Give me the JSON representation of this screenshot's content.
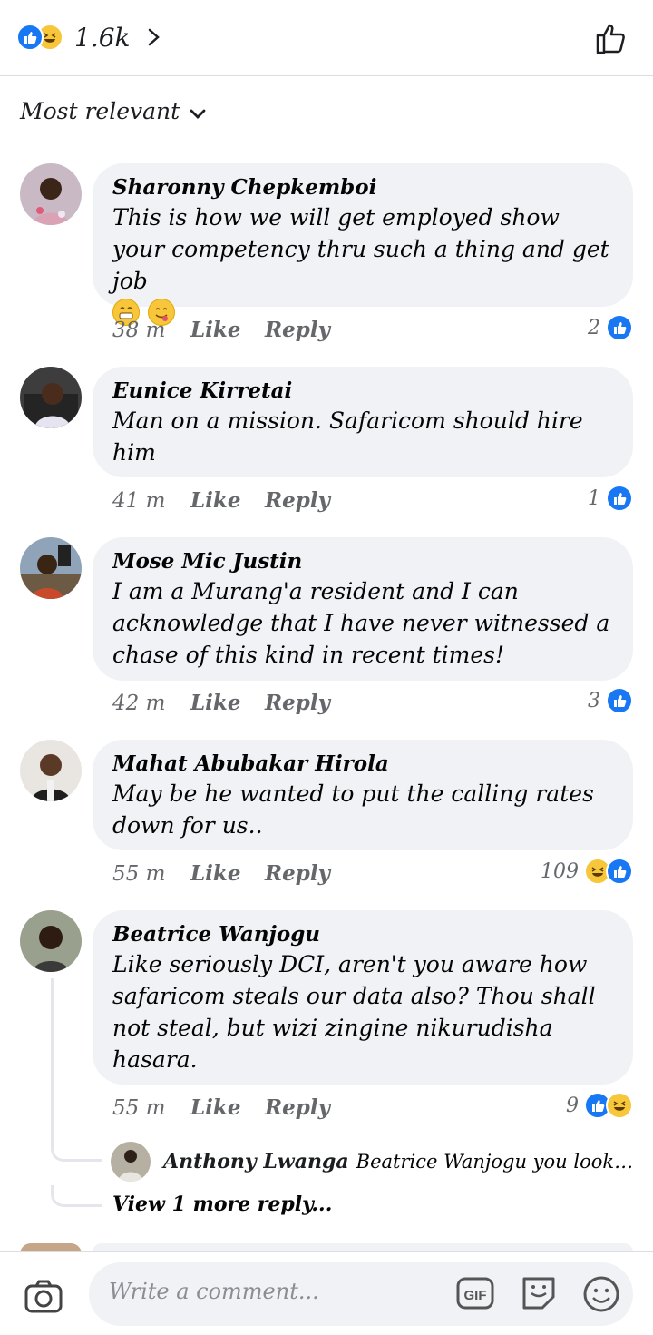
{
  "header": {
    "reaction_count": "1.6k",
    "reaction_icons": [
      "like-icon",
      "haha-icon"
    ]
  },
  "sort": {
    "label": "Most relevant"
  },
  "comments": [
    {
      "name": "Sharonny Chepkemboi",
      "text": "This is how we will get employed show your competency thru such a thing and get job",
      "emojis": [
        "grin-icon",
        "yum-icon"
      ],
      "time": "38 m",
      "like": "Like",
      "reply": "Reply",
      "reactions": "2",
      "reaction_icons": [
        "like-icon"
      ]
    },
    {
      "name": "Eunice Kirretai",
      "text": "Man on a mission. Safaricom should hire him",
      "time": "41 m",
      "like": "Like",
      "reply": "Reply",
      "reactions": "1",
      "reaction_icons": [
        "like-icon"
      ]
    },
    {
      "name": "Mose Mic Justin",
      "text": "I am a Murang'a resident and I can acknowledge that I have never witnessed a chase of this kind in recent times!",
      "time": "42 m",
      "like": "Like",
      "reply": "Reply",
      "reactions": "3",
      "reaction_icons": [
        "like-icon"
      ]
    },
    {
      "name": "Mahat Abubakar Hirola",
      "text": "May be he wanted to put the calling rates down for us..",
      "time": "55 m",
      "like": "Like",
      "reply": "Reply",
      "reactions": "109",
      "reaction_icons": [
        "haha-icon",
        "like-icon"
      ]
    },
    {
      "name": "Beatrice Wanjogu",
      "text": "Like seriously DCI, aren't you aware how safaricom steals our data also? Thou shall not steal, but wizi zingine nikurudisha hasara.",
      "time": "55 m",
      "like": "Like",
      "reply": "Reply",
      "reactions": "9",
      "reaction_icons": [
        "like-icon",
        "haha-icon"
      ]
    }
  ],
  "reply_preview": {
    "name": "Anthony Lwanga",
    "text": "Beatrice Wanjogu you look sus...",
    "more": "View 1 more reply..."
  },
  "composer": {
    "placeholder": "Write a comment...",
    "gif_label": "GIF"
  },
  "colors": {
    "like_blue": "#1877f2",
    "haha_yellow": "#f7c63a",
    "bubble_bg": "#f0f2f5",
    "meta_gray": "#65676b"
  }
}
